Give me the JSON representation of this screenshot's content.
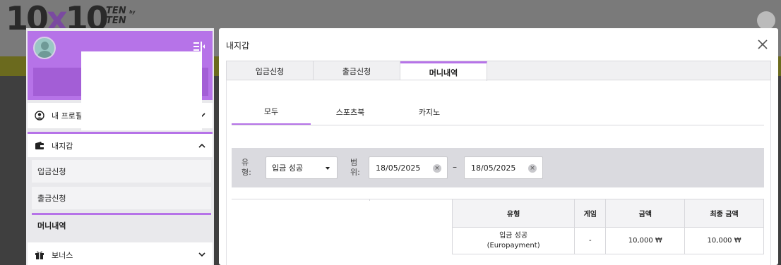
{
  "site": {
    "logo_main_left": "10",
    "logo_x": "x",
    "logo_main_right": "10",
    "logo_small_1": "TEN",
    "logo_by": "by",
    "logo_small_2": "TEN"
  },
  "sidebar": {
    "profile_item": "내 프로필",
    "wallet_item": "내지갑",
    "wallet_subitems": [
      "입금신청",
      "출금신청",
      "머니내역"
    ],
    "bonus_item": "보너스"
  },
  "panel": {
    "title": "내지갑",
    "tabs": [
      "입금신청",
      "출금신청",
      "머니내역"
    ],
    "active_tab": "머니내역",
    "subtabs": [
      "모두",
      "스포츠북",
      "카지노"
    ],
    "active_subtab": "모두"
  },
  "filters": {
    "type_label": "유형:",
    "type_value": "입금 성공",
    "range_label": "범위:",
    "date_from": "18/05/2025",
    "date_to": "18/05/2025",
    "range_separator": "–",
    "clear_glyph": "×"
  },
  "table": {
    "headers": [
      "유형",
      "게임",
      "금액",
      "최종 금액"
    ],
    "rows": [
      {
        "type_line1": "입금 성공",
        "type_line2": "(Europayment)",
        "game": "-",
        "amount": "10,000 ₩",
        "final_amount": "10,000 ₩"
      }
    ]
  },
  "colors": {
    "accent": "#b673e8",
    "accent_dark": "#a35ed6",
    "filter_bg": "#dadadf"
  }
}
